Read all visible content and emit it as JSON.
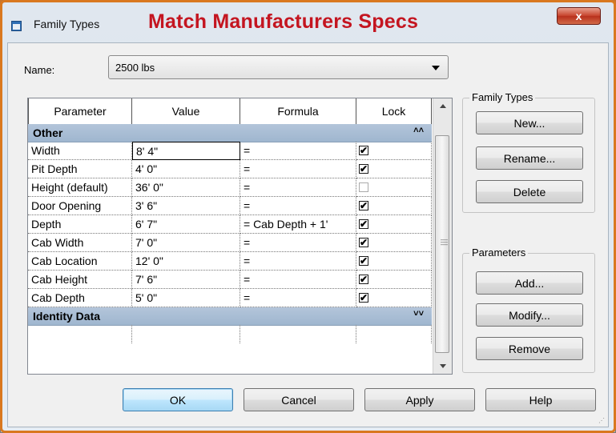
{
  "window": {
    "title": "Family Types",
    "overlay_caption": "Match Manufacturers Specs",
    "close_label": "x"
  },
  "name_field": {
    "label": "Name:",
    "value": "2500 lbs"
  },
  "table": {
    "columns": [
      "Parameter",
      "Value",
      "Formula",
      "Lock"
    ],
    "groups": [
      {
        "label": "Other",
        "chevron": "˄˄",
        "rows": [
          {
            "param": "Width",
            "value": "8'  4\"",
            "formula": "=",
            "lock": true
          },
          {
            "param": "Pit Depth",
            "value": "4'  0\"",
            "formula": "=",
            "lock": true
          },
          {
            "param": "Height (default)",
            "value": "36'  0\"",
            "formula": "=",
            "lock": false
          },
          {
            "param": "Door Opening",
            "value": "3'  6\"",
            "formula": "=",
            "lock": true
          },
          {
            "param": "Depth",
            "value": "6'  7\"",
            "formula": "= Cab Depth + 1'",
            "lock": true
          },
          {
            "param": "Cab Width",
            "value": "7'  0\"",
            "formula": "=",
            "lock": true
          },
          {
            "param": "Cab Location",
            "value": "12'  0\"",
            "formula": "=",
            "lock": true
          },
          {
            "param": "Cab Height",
            "value": "7'  6\"",
            "formula": "=",
            "lock": true
          },
          {
            "param": "Cab Depth",
            "value": "5'  0\"",
            "formula": "=",
            "lock": true
          }
        ]
      },
      {
        "label": "Identity Data",
        "chevron": "˅˅",
        "rows": []
      }
    ]
  },
  "family_types_box": {
    "title": "Family Types",
    "new": "New...",
    "rename": "Rename...",
    "delete": "Delete"
  },
  "parameters_box": {
    "title": "Parameters",
    "add": "Add...",
    "modify": "Modify...",
    "remove": "Remove"
  },
  "footer": {
    "ok": "OK",
    "cancel": "Cancel",
    "apply": "Apply",
    "help": "Help"
  },
  "colors": {
    "overlay_title": "#c41520",
    "group_header": "#a9bed5",
    "window_border": "#d9781f"
  }
}
